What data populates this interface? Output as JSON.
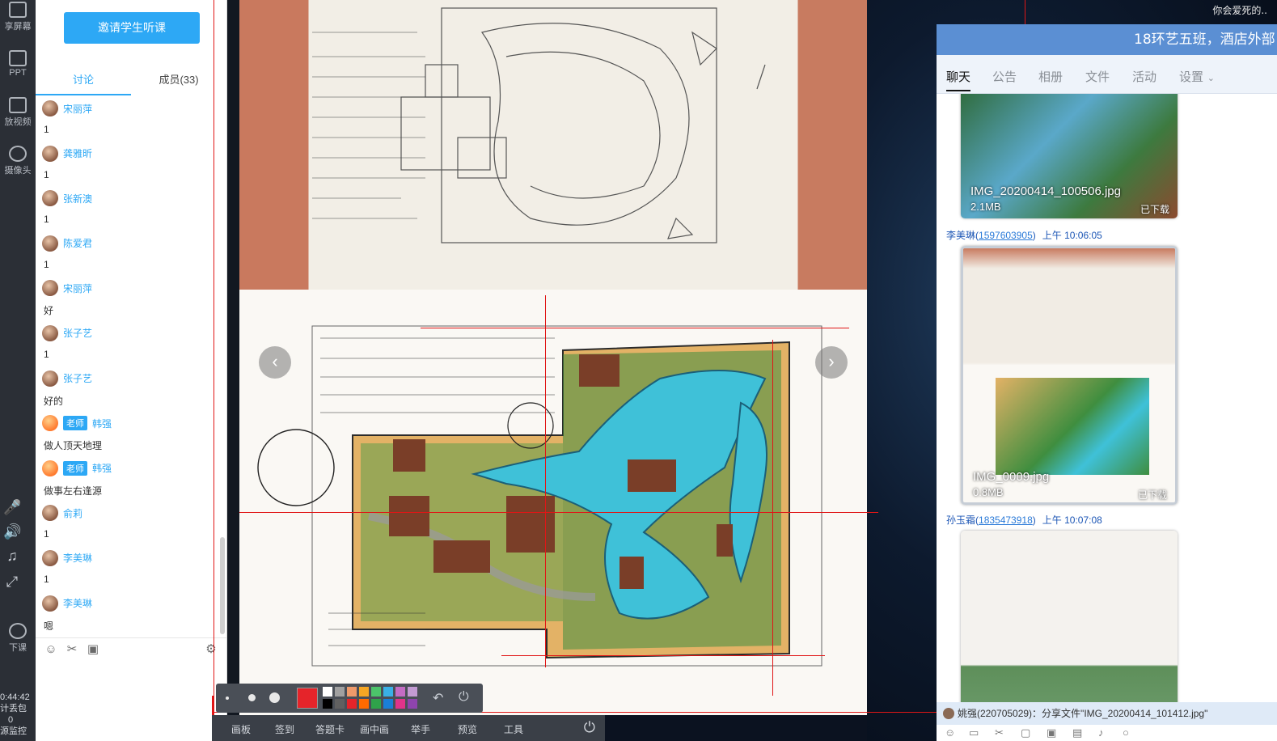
{
  "desktop": {
    "caption": "你会爱死的.."
  },
  "left_toolbar": {
    "share_screen": "享屏幕",
    "ppt": "PPT",
    "play_video": "放视频",
    "camera": "摄像头",
    "end_class": "下课",
    "timer": "0:44:42",
    "stat1": "计丢包",
    "stat2": "0",
    "stat3": "源监控"
  },
  "chat_panel": {
    "invite_button": "邀请学生听课",
    "tabs": {
      "discuss": "讨论",
      "members": "成员(33)"
    },
    "messages": [
      {
        "name": "宋丽萍",
        "text": "1",
        "teacher": false
      },
      {
        "name": "龚雅昕",
        "text": "1",
        "teacher": false
      },
      {
        "name": "张新澳",
        "text": "1",
        "teacher": false
      },
      {
        "name": "陈爱君",
        "text": "1",
        "teacher": false
      },
      {
        "name": "宋丽萍",
        "text": "好",
        "teacher": false
      },
      {
        "name": "张子艺",
        "text": "1",
        "teacher": false
      },
      {
        "name": "张子艺",
        "text": "好的",
        "teacher": false
      },
      {
        "name": "韩强",
        "text": "做人顶天地理",
        "teacher": true,
        "badge": "老师"
      },
      {
        "name": "韩强",
        "text": "做事左右逢源",
        "teacher": true,
        "badge": "老师"
      },
      {
        "name": "俞莉",
        "text": "1",
        "teacher": false
      },
      {
        "name": "李美琳",
        "text": "1",
        "teacher": false
      },
      {
        "name": "李美琳",
        "text": "嗯",
        "teacher": false
      }
    ]
  },
  "bottom_bar": {
    "items": [
      "画板",
      "签到",
      "答题卡",
      "画中画",
      "举手",
      "预览",
      "工具"
    ]
  },
  "palette": {
    "current_color": "#e5242a",
    "swatches": [
      "#ffffff",
      "#a0a0a0",
      "#ef9a6a",
      "#f5a623",
      "#4cc36a",
      "#3ab0e6",
      "#c46cc4",
      "#c39bd3",
      "#000000",
      "#606060",
      "#e5242a",
      "#ff6a00",
      "#2fa34a",
      "#1a7fd6",
      "#e0338a",
      "#8e44ad"
    ]
  },
  "group_window": {
    "title": "18环艺五班，酒店外部",
    "tabs": [
      "聊天",
      "公告",
      "相册",
      "文件",
      "活动",
      "设置"
    ],
    "files": [
      {
        "name": "IMG_20200414_100506.jpg",
        "size": "2.1MB",
        "status": "已下载"
      },
      {
        "name": "IMG_0009.jpg",
        "size": "0.8MB",
        "status": "已下载"
      }
    ],
    "senders": [
      {
        "name": "李美琳",
        "qq": "1597603905",
        "time": "上午 10:06:05"
      },
      {
        "name": "孙玉霜",
        "qq": "1835473918",
        "time": "上午 10:07:08"
      }
    ],
    "notify": "姚强(220705029)：分享文件\"IMG_20200414_101412.jpg\""
  }
}
